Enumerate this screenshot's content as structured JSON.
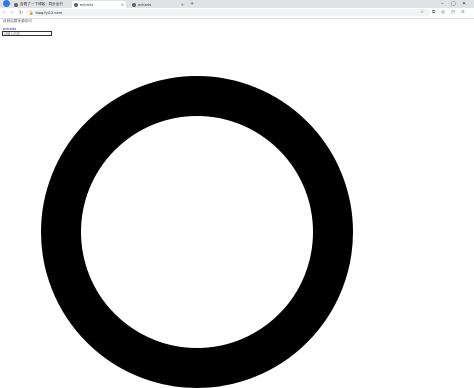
{
  "browser": {
    "tabs": [
      {
        "title": "查看了一下博客 · 同步出行"
      },
      {
        "title": "echarts"
      },
      {
        "title": "echarts"
      }
    ],
    "new_tab_icon": "plus-icon",
    "address": {
      "url": "blog.fyj12.com"
    }
  },
  "page": {
    "intro_text": "页码加载来源访问",
    "link_label": "echarts",
    "input_placeholder": "请输入内容"
  },
  "colors": {
    "ring": "#000000",
    "tab_strip": "#dfe1e5"
  }
}
